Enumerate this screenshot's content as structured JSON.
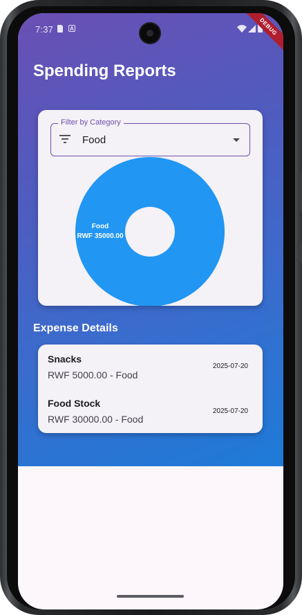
{
  "status": {
    "time": "7:37",
    "debug_banner": "DEBUG"
  },
  "app": {
    "title": "Spending Reports"
  },
  "filter": {
    "label": "Filter by Category",
    "selected": "Food"
  },
  "chart_data": {
    "type": "pie",
    "categories": [
      "Food"
    ],
    "values": [
      35000.0
    ],
    "slice_labels": [
      "Food\nRWF 35000.00"
    ],
    "label_lines": [
      "Food",
      "RWF 35000.00"
    ],
    "colors": [
      "#2196f3"
    ],
    "donut": true
  },
  "details": {
    "title": "Expense Details",
    "items": [
      {
        "name": "Snacks",
        "subtitle": "RWF 5000.00 - Food",
        "date": "2025-07-20"
      },
      {
        "name": "Food Stock",
        "subtitle": "RWF 30000.00 - Food",
        "date": "2025-07-20"
      }
    ]
  },
  "colors": {
    "accent": "#6e4fa8",
    "slice": "#2196f3",
    "gradient_start": "#6a4fb4",
    "gradient_end": "#1e7bd8"
  }
}
